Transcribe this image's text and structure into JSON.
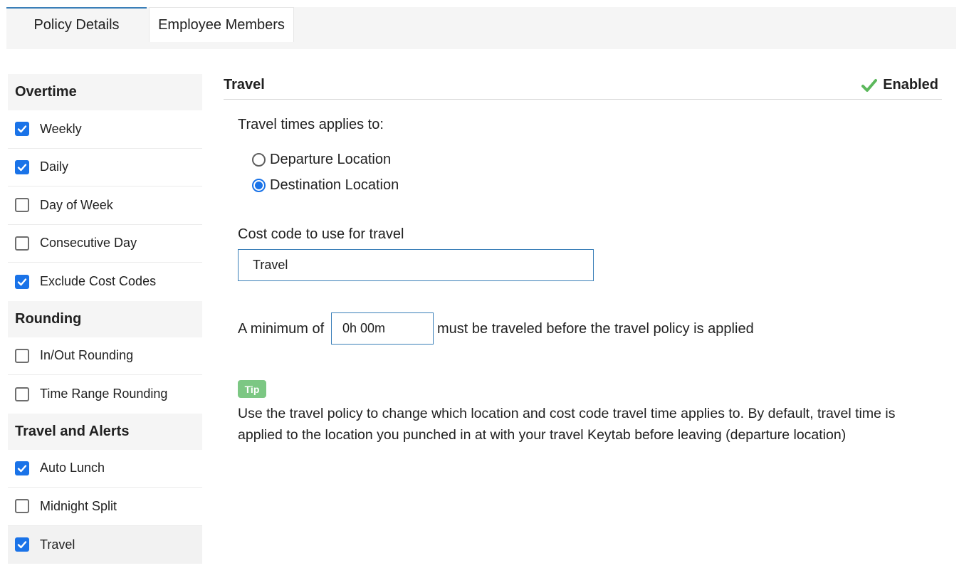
{
  "tabs": [
    {
      "label": "Policy Details"
    },
    {
      "label": "Employee Members"
    }
  ],
  "sidebar": {
    "sections": [
      {
        "title": "Overtime",
        "items": [
          {
            "label": "Weekly",
            "checked": true
          },
          {
            "label": "Daily",
            "checked": true
          },
          {
            "label": "Day of Week",
            "checked": false
          },
          {
            "label": "Consecutive Day",
            "checked": false
          },
          {
            "label": "Exclude Cost Codes",
            "checked": true
          }
        ]
      },
      {
        "title": "Rounding",
        "items": [
          {
            "label": "In/Out Rounding",
            "checked": false
          },
          {
            "label": "Time Range Rounding",
            "checked": false
          }
        ]
      },
      {
        "title": "Travel and Alerts",
        "items": [
          {
            "label": "Auto Lunch",
            "checked": true
          },
          {
            "label": "Midnight Split",
            "checked": false
          },
          {
            "label": "Travel",
            "checked": true
          }
        ]
      }
    ]
  },
  "main": {
    "title": "Travel",
    "status": "Enabled",
    "applies_label": "Travel times applies to:",
    "radio_options": [
      {
        "label": "Departure Location",
        "selected": false
      },
      {
        "label": "Destination Location",
        "selected": true
      }
    ],
    "cost_code_label": "Cost code to use for travel",
    "cost_code_value": "Travel",
    "minimum_prefix": "A minimum of",
    "minimum_value": "0h 00m",
    "minimum_suffix": "must be traveled before the travel policy is applied",
    "tip_label": "Tip",
    "tip_text": "Use the travel policy to change which location and cost code travel time applies to. By default, travel time is applied to the location you punched in at with your travel Keytab before leaving (departure location)"
  },
  "colors": {
    "accent": "#1a73e8",
    "tab_border": "#3a7fb8",
    "success": "#5cb85c",
    "tip": "#7cc783"
  }
}
